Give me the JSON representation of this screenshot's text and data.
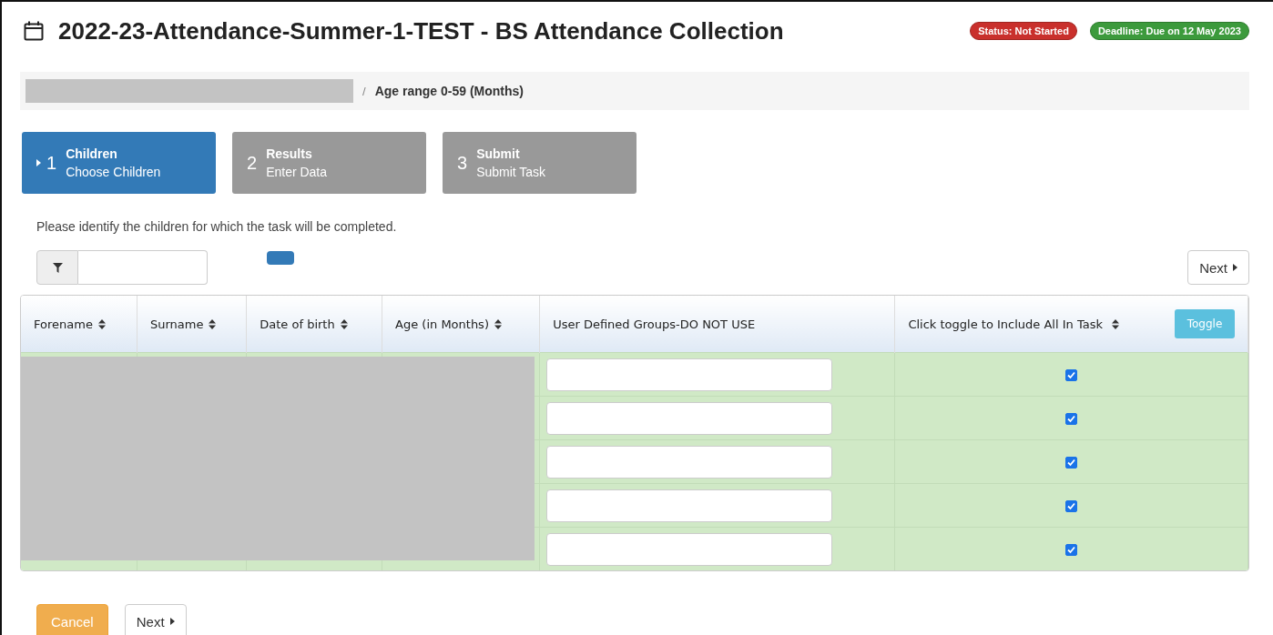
{
  "header": {
    "title": "2022-23-Attendance-Summer-1-TEST - BS Attendance Collection",
    "status": "Status: Not Started",
    "deadline": "Deadline: Due on 12 May 2023"
  },
  "breadcrumb": {
    "separator": "/",
    "label": "Age range 0-59 (Months)"
  },
  "steps": [
    {
      "number": "1",
      "title": "Children",
      "subtitle": "Choose Children",
      "selected": true
    },
    {
      "number": "2",
      "title": "Results",
      "subtitle": "Enter Data",
      "selected": false
    },
    {
      "number": "3",
      "title": "Submit",
      "subtitle": "Submit Task",
      "selected": false
    }
  ],
  "instruction": "Please identify the children for which the task will be completed.",
  "top_next": "Next",
  "table": {
    "columns": [
      {
        "label": "Forename",
        "sortable": true
      },
      {
        "label": "Surname",
        "sortable": true
      },
      {
        "label": "Date of birth",
        "sortable": true
      },
      {
        "label": "Age (in Months)",
        "sortable": true
      },
      {
        "label": "User Defined Groups-DO NOT USE",
        "sortable": false
      },
      {
        "label": "Click toggle to Include All In Task",
        "sortable": true
      }
    ],
    "toggle": "Toggle",
    "rows": [
      {
        "included": true
      },
      {
        "included": true
      },
      {
        "included": true
      },
      {
        "included": true
      },
      {
        "included": true
      }
    ]
  },
  "buttons": {
    "cancel": "Cancel",
    "next": "Next"
  }
}
